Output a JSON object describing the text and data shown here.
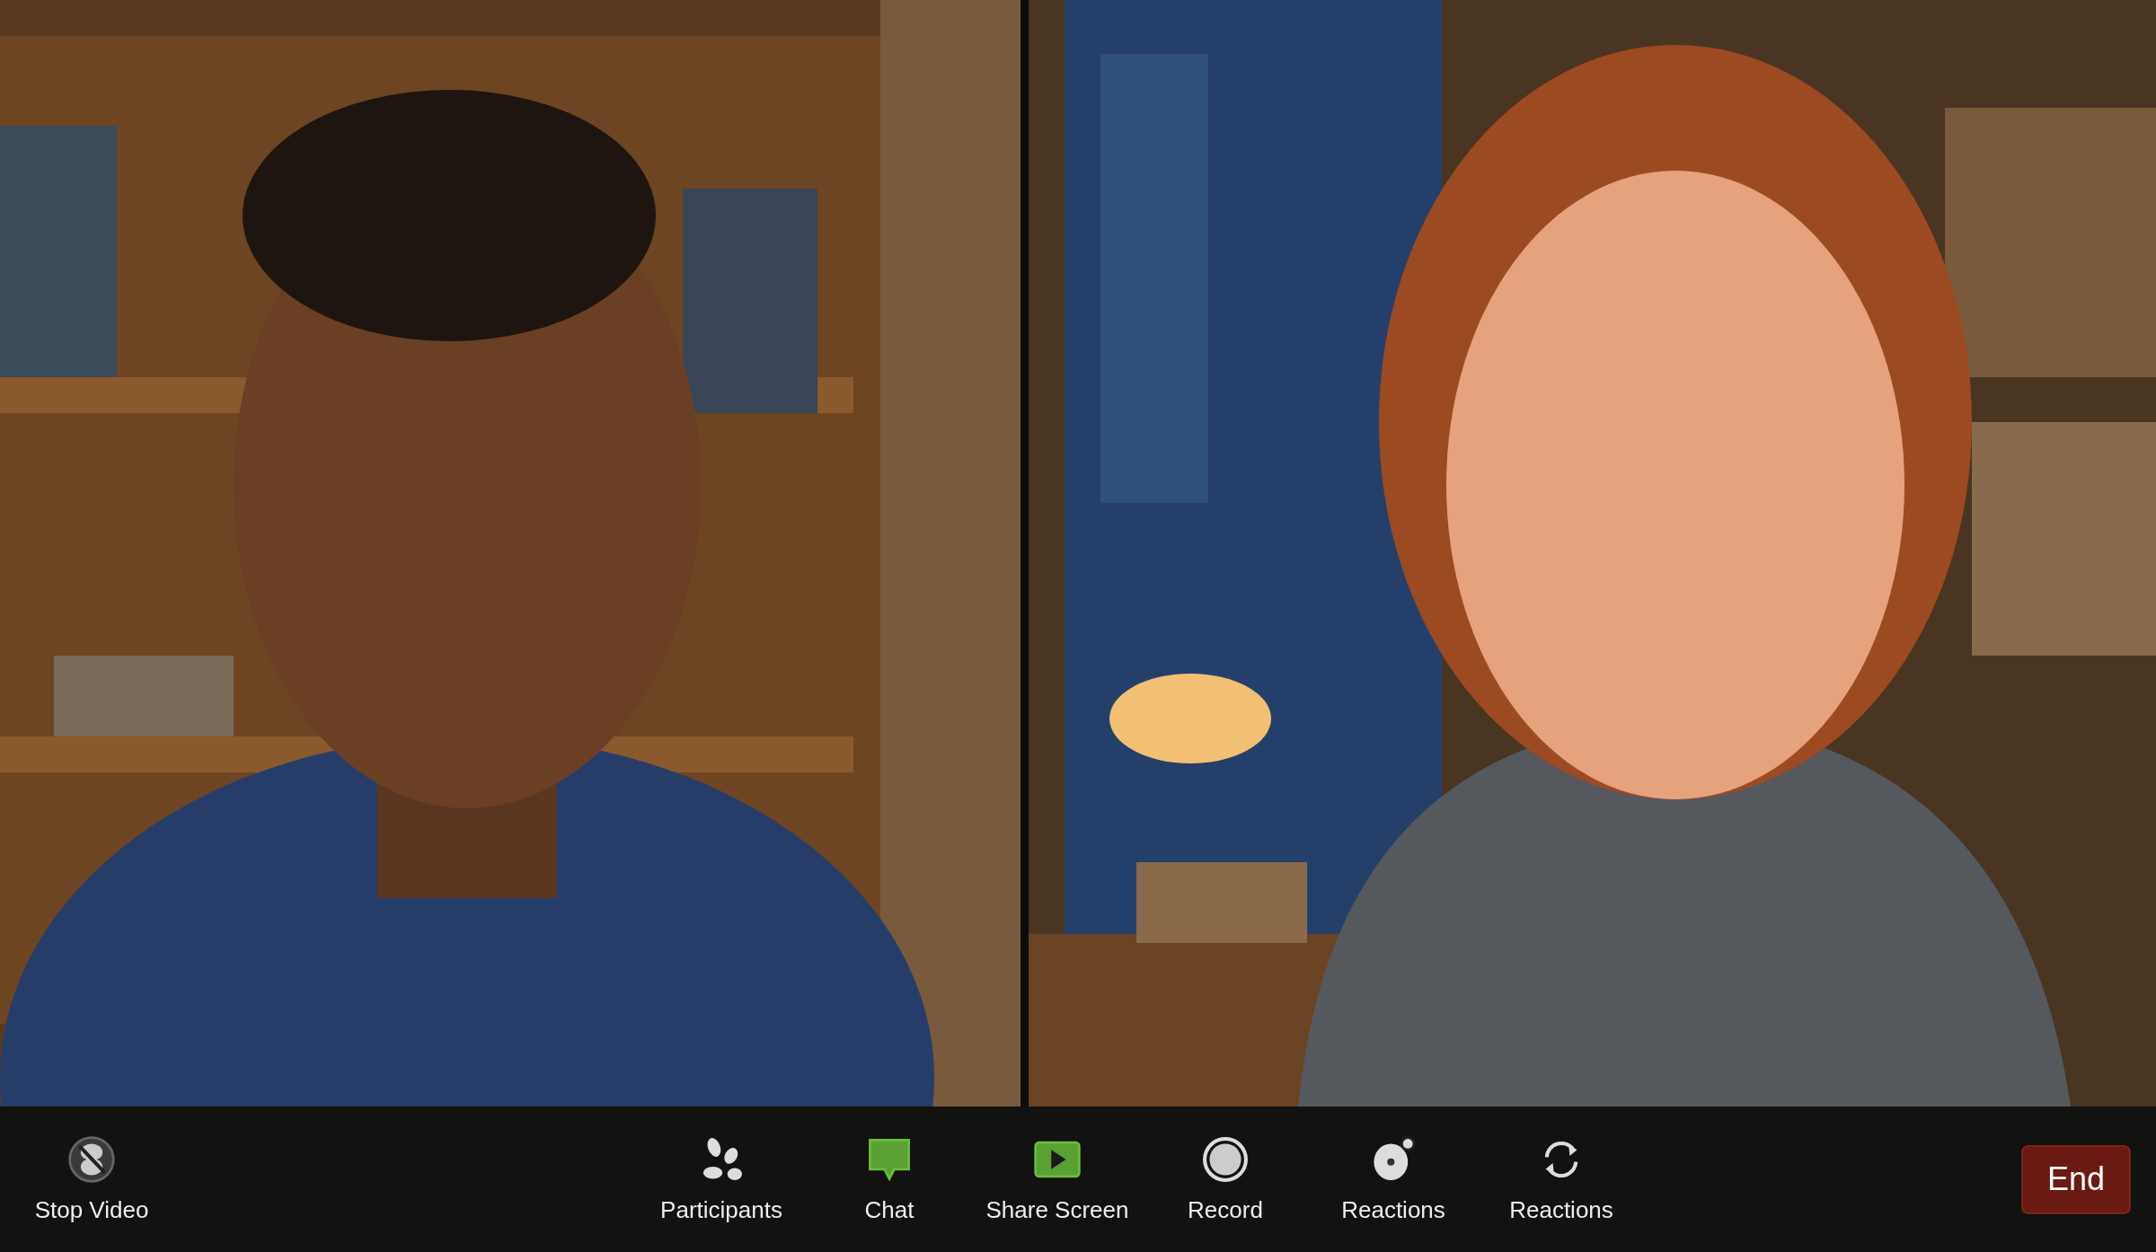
{
  "toolbar": {
    "buttons": [
      {
        "kind": "video",
        "label": "Stop Video"
      },
      {
        "kind": "participants",
        "label": "Participants"
      },
      {
        "kind": "chat",
        "label": "Chat"
      },
      {
        "kind": "share",
        "label": "Share Screen"
      },
      {
        "kind": "record",
        "label": "Record"
      },
      {
        "kind": "reactions",
        "label": "Reactions"
      },
      {
        "kind": "refresh",
        "label": "Reactions"
      }
    ],
    "end_button": "End"
  }
}
